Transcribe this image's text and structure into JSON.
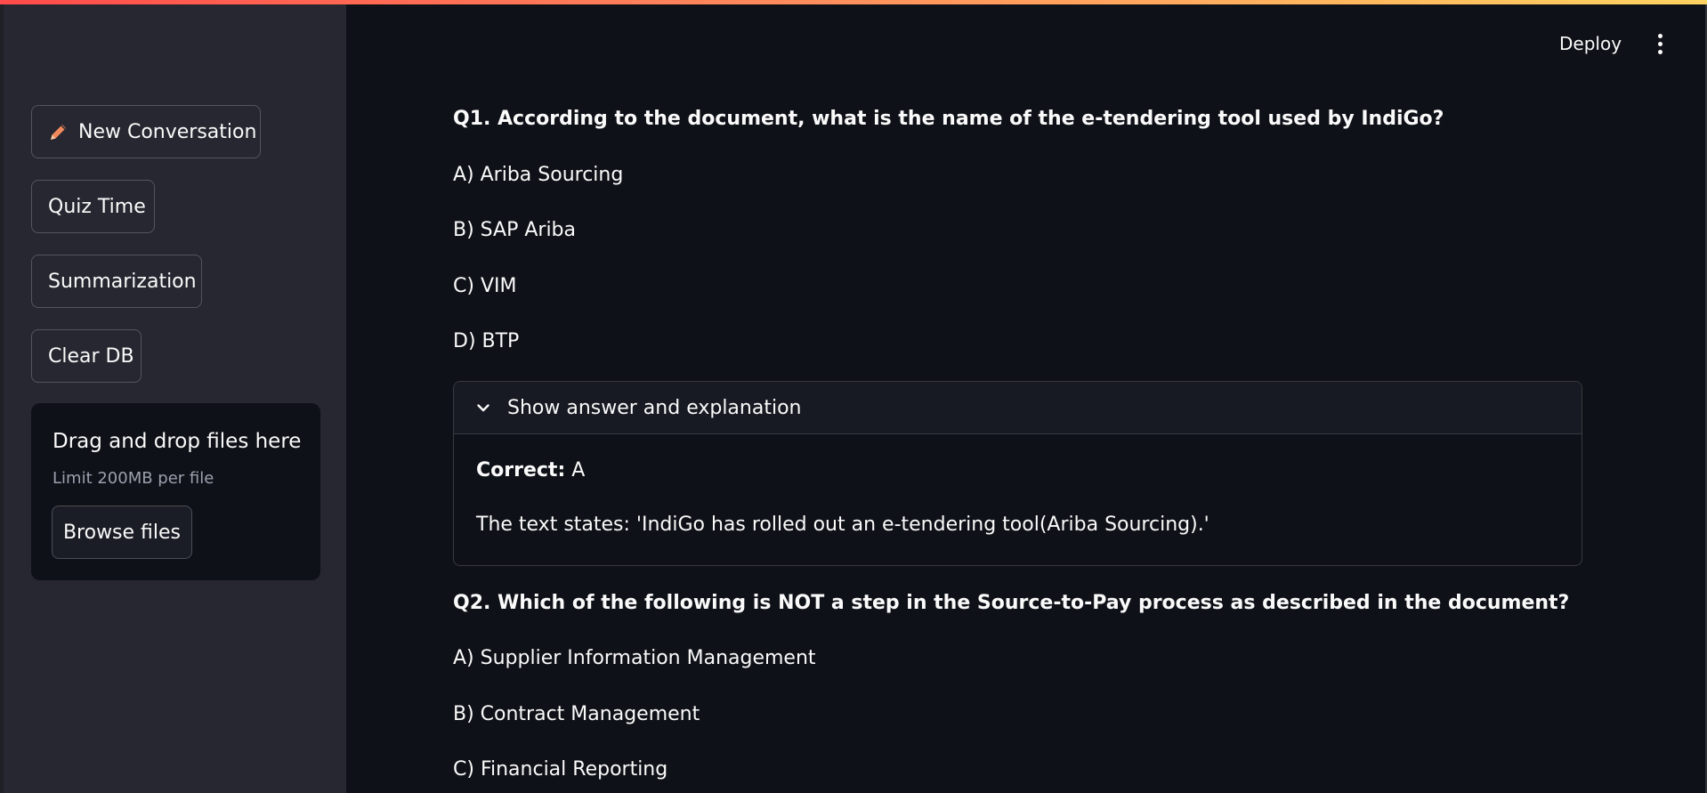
{
  "header": {
    "deploy_label": "Deploy",
    "menu_icon": "kebab-vertical-icon",
    "accent_gradient": [
      "#ff4b4b",
      "#ffd460"
    ]
  },
  "sidebar": {
    "buttons": [
      {
        "label": "New Conversation",
        "icon": "pencil-icon"
      },
      {
        "label": "Quiz Time"
      },
      {
        "label": "Summarization"
      },
      {
        "label": "Clear DB"
      }
    ],
    "uploader": {
      "title": "Drag and drop files here",
      "limit": "Limit 200MB per file",
      "browse_label": "Browse files"
    }
  },
  "quiz": {
    "q1": {
      "title": "Q1. According to the document, what is the name of the e-tendering tool used by IndiGo?",
      "options": [
        "A) Ariba Sourcing",
        "B) SAP Ariba",
        "C) VIM",
        "D) BTP"
      ],
      "expander": {
        "label": "Show answer and explanation",
        "correct_label": "Correct:",
        "correct_value": "A",
        "explanation": "The text states: 'IndiGo has rolled out an e-tendering tool(Ariba Sourcing).'"
      }
    },
    "q2": {
      "title": "Q2. Which of the following is NOT a step in the Source-to-Pay process as described in the document?",
      "options": [
        "A) Supplier Information Management",
        "B) Contract Management",
        "C) Financial Reporting"
      ]
    }
  },
  "colors": {
    "background": "#0e1117",
    "sidebar": "#262730",
    "text": "#fafafa",
    "muted": "#9ba0ad",
    "pencil": "#f08a5d"
  }
}
